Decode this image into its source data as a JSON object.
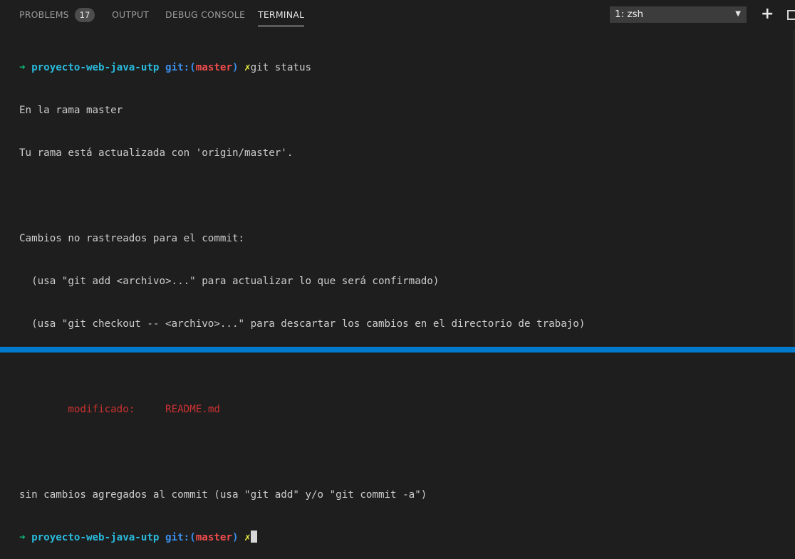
{
  "panel": {
    "tabs": {
      "problems": "PROBLEMS",
      "output": "OUTPUT",
      "debug_console": "DEBUG CONSOLE",
      "terminal": "TERMINAL"
    },
    "problems_count": "17",
    "terminal_select": "1: zsh",
    "select_arrow": "▼",
    "plus_icon": "+"
  },
  "terminal": {
    "prompt_arrow": "➜",
    "dir": "proyecto-web-java-utp",
    "git_label": "git:(",
    "branch": "master",
    "git_close": ")",
    "dirty_mark": "✗",
    "command": "git status",
    "lines": {
      "l2": "En la rama master",
      "l3": "Tu rama está actualizada con 'origin/master'.",
      "l5": "Cambios no rastreados para el commit:",
      "l6": "  (usa \"git add <archivo>...\" para actualizar lo que será confirmado)",
      "l7": "  (usa \"git checkout -- <archivo>...\" para descartar los cambios en el directorio de trabajo)",
      "modified_label": "modificado:",
      "modified_file": "README.md",
      "l11": "sin cambios agregados al commit (usa \"git add\" y/o \"git commit -a\")"
    }
  },
  "colors": {
    "background": "#1e1e1e",
    "accent": "#007acc",
    "prompt_green": "#0dbc79",
    "dir_cyan": "#29b8db",
    "git_blue": "#3b8eea",
    "branch_red": "#f14c4c",
    "mark_yellow": "#f5f543",
    "modified_red": "#cd3131"
  }
}
